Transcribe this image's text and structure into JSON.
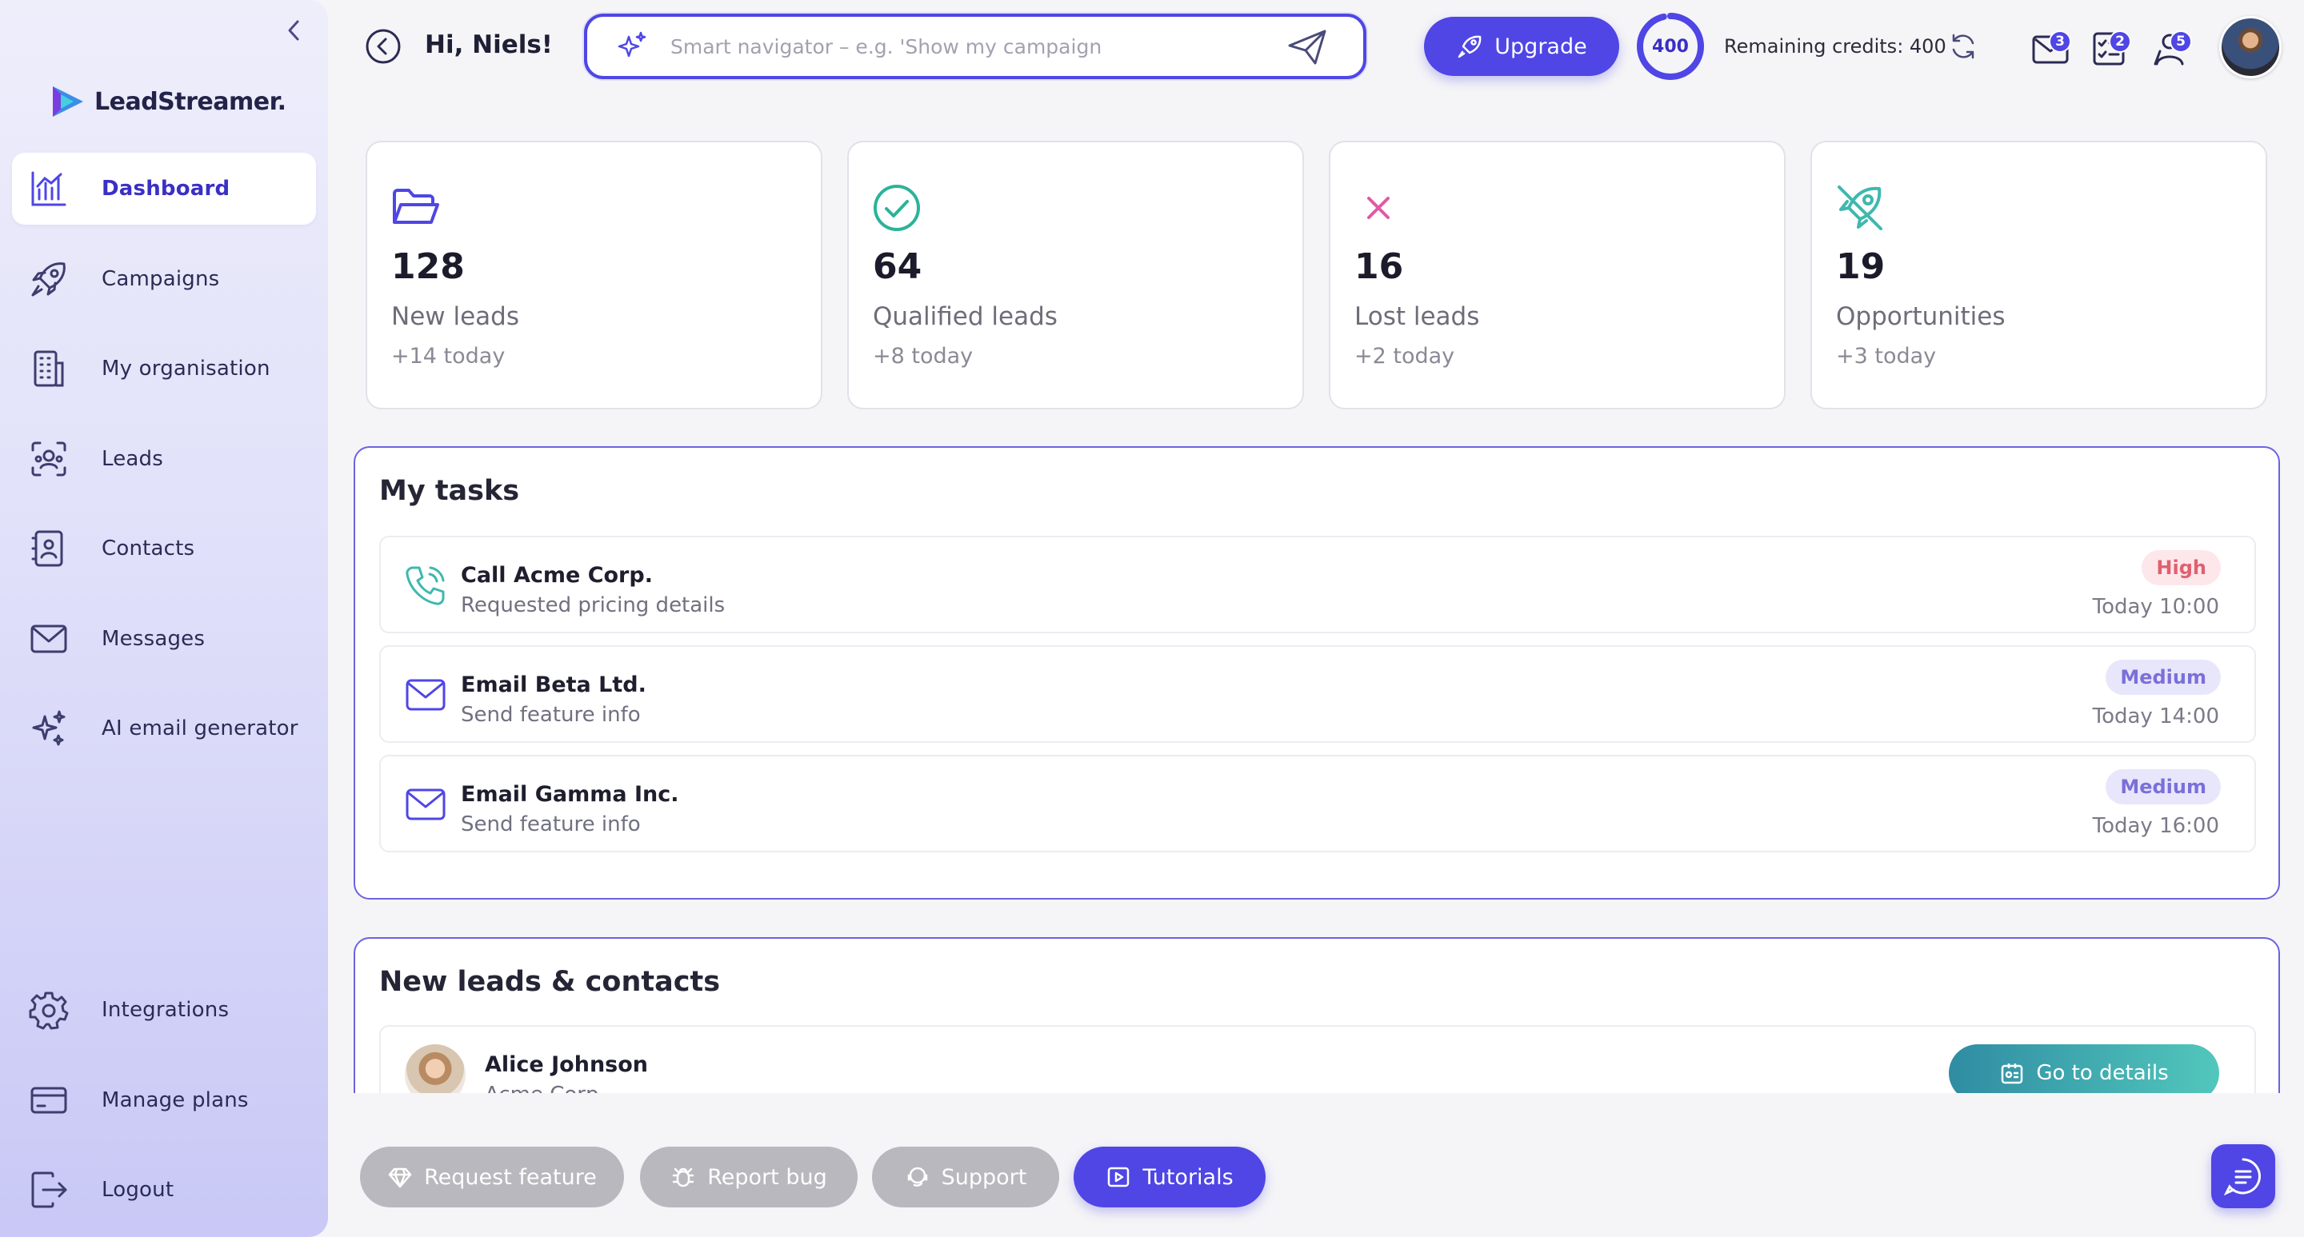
{
  "header": {
    "greeting": "Hi, Niels!",
    "search_placeholder": "Smart navigator – e.g. 'Show my campaign",
    "upgrade_label": "Upgrade",
    "credits_ring_value": "400",
    "credits_text": "Remaining credits: 400",
    "notification_badges": {
      "messages": "3",
      "tasks": "2",
      "leads": "5"
    }
  },
  "brand": {
    "name": "LeadStreamer."
  },
  "sidebar": {
    "items": [
      {
        "label": "Dashboard",
        "icon": "chart-icon",
        "active": true
      },
      {
        "label": "Campaigns",
        "icon": "rocket-icon"
      },
      {
        "label": "My organisation",
        "icon": "building-icon"
      },
      {
        "label": "Leads",
        "icon": "face-scan-icon"
      },
      {
        "label": "Contacts",
        "icon": "contact-book-icon"
      },
      {
        "label": "Messages",
        "icon": "envelope-icon"
      },
      {
        "label": "AI email generator",
        "icon": "sparkles-icon"
      }
    ],
    "bottom_items": [
      {
        "label": "Integrations",
        "icon": "gear-icon"
      },
      {
        "label": "Manage plans",
        "icon": "credit-card-icon"
      },
      {
        "label": "Logout",
        "icon": "logout-icon"
      }
    ]
  },
  "stats": [
    {
      "value": "128",
      "label": "New leads",
      "delta": "+14 today",
      "icon": "folder-icon",
      "color": "#4f46e5"
    },
    {
      "value": "64",
      "label": "Qualified leads",
      "delta": "+8 today",
      "icon": "check-circle-icon",
      "color": "#2bb39a"
    },
    {
      "value": "16",
      "label": "Lost leads",
      "delta": "+2 today",
      "icon": "x-icon",
      "color": "#e05aa8"
    },
    {
      "value": "19",
      "label": "Opportunities",
      "delta": "+3 today",
      "icon": "rocket-off-icon",
      "color": "#3fb8ae"
    }
  ],
  "tasks": {
    "title": "My tasks",
    "items": [
      {
        "title": "Call Acme Corp.",
        "subtitle": "Requested pricing details",
        "priority": "High",
        "time": "Today 10:00",
        "icon": "phone-icon"
      },
      {
        "title": "Email Beta Ltd.",
        "subtitle": "Send feature info",
        "priority": "Medium",
        "time": "Today 14:00",
        "icon": "mail-icon"
      },
      {
        "title": "Email Gamma Inc.",
        "subtitle": "Send feature info",
        "priority": "Medium",
        "time": "Today 16:00",
        "icon": "mail-icon"
      }
    ]
  },
  "new_leads": {
    "title": "New leads & contacts",
    "items": [
      {
        "name": "Alice Johnson",
        "company": "Acme Corp",
        "action_label": "Go to details"
      }
    ]
  },
  "footer": {
    "request_feature": "Request feature",
    "report_bug": "Report bug",
    "support": "Support",
    "tutorials": "Tutorials"
  },
  "colors": {
    "accent": "#4f46e5",
    "teal": "#2f8ca3",
    "high_priority": "#e06070",
    "medium_priority": "#7a70d8"
  }
}
